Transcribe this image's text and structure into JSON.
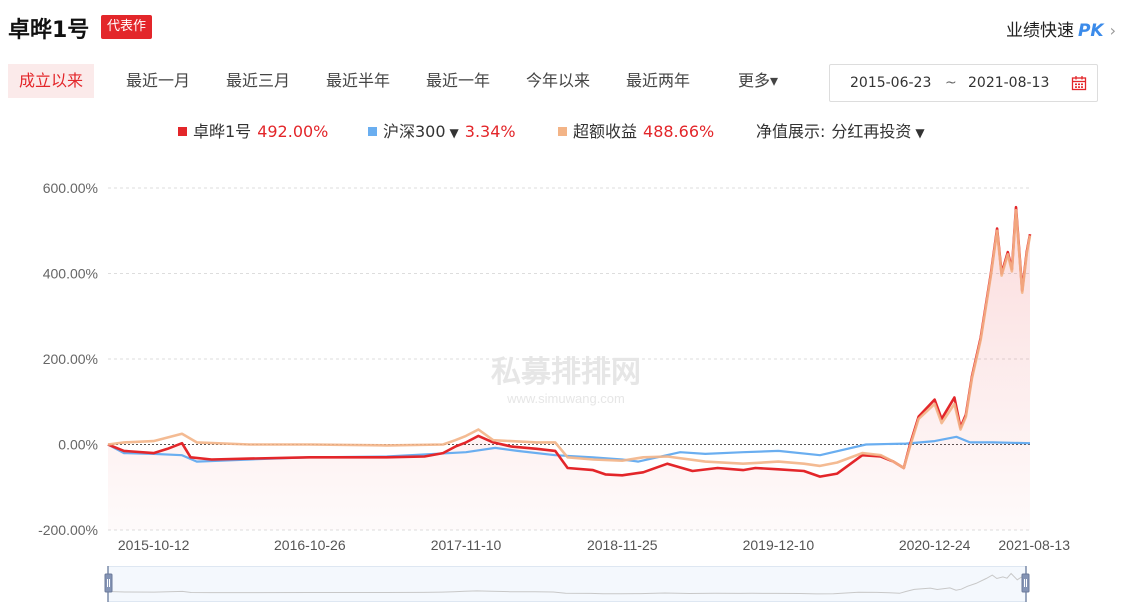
{
  "header": {
    "fund_name": "卓晔1号",
    "badge": "代表作",
    "pk_prefix": "业绩快速",
    "pk_strong": "PK",
    "pk_chevron": "›"
  },
  "tabs": [
    {
      "label": "成立以来",
      "active": true
    },
    {
      "label": "最近一月",
      "active": false
    },
    {
      "label": "最近三月",
      "active": false
    },
    {
      "label": "最近半年",
      "active": false
    },
    {
      "label": "最近一年",
      "active": false
    },
    {
      "label": "今年以来",
      "active": false
    },
    {
      "label": "最近两年",
      "active": false
    },
    {
      "label": "更多▾",
      "active": false
    }
  ],
  "date_range": {
    "start": "2015-06-23",
    "separator": "~",
    "end": "2021-08-13"
  },
  "legend": {
    "fund": {
      "label": "卓晔1号",
      "value": "492.00%",
      "color": "#e3262a"
    },
    "benchmark": {
      "label": "沪深300",
      "caret": "▼",
      "value": "3.34%",
      "color": "#6aaef0"
    },
    "excess": {
      "label": "超额收益",
      "value": "488.66%",
      "color": "#f3b487"
    },
    "nav_display": {
      "label": "净值展示:",
      "value": "分红再投资",
      "caret": "▼"
    }
  },
  "watermark": {
    "cn": "私募排排网",
    "en": "www.simuwang.com"
  },
  "colors": {
    "accent": "#e3262a",
    "benchmark": "#6aaef0",
    "excess": "#f3b487",
    "grid": "#dddddd"
  },
  "chart_data": {
    "type": "line",
    "title": "",
    "xlabel": "",
    "ylabel": "",
    "ylim": [
      -200,
      600
    ],
    "y_ticks": [
      "600.00%",
      "400.00%",
      "200.00%",
      "0.00%",
      "-200.00%"
    ],
    "y_tick_values": [
      600,
      400,
      200,
      0,
      -200
    ],
    "x_range": [
      "2015-06-23",
      "2021-08-13"
    ],
    "x_ticks": [
      "2015-10-12",
      "2016-10-26",
      "2017-11-10",
      "2018-11-25",
      "2019-12-10",
      "2020-12-24",
      "2021-08-13"
    ],
    "grid": true,
    "zero_line": "dashed",
    "legend_position": "top-center",
    "series": [
      {
        "name": "卓晔1号",
        "color": "#e3262a",
        "points": [
          [
            "2015-06-23",
            0
          ],
          [
            "2015-08-01",
            -15
          ],
          [
            "2015-10-12",
            -20
          ],
          [
            "2015-11-15",
            -10
          ],
          [
            "2015-12-20",
            3
          ],
          [
            "2016-01-10",
            -30
          ],
          [
            "2016-03-01",
            -35
          ],
          [
            "2016-06-01",
            -33
          ],
          [
            "2016-10-26",
            -30
          ],
          [
            "2017-02-01",
            -30
          ],
          [
            "2017-05-01",
            -30
          ],
          [
            "2017-08-01",
            -28
          ],
          [
            "2017-09-15",
            -20
          ],
          [
            "2017-10-15",
            -5
          ],
          [
            "2017-11-10",
            5
          ],
          [
            "2017-12-10",
            20
          ],
          [
            "2018-01-15",
            5
          ],
          [
            "2018-03-01",
            -5
          ],
          [
            "2018-05-01",
            -10
          ],
          [
            "2018-06-15",
            -15
          ],
          [
            "2018-07-15",
            -55
          ],
          [
            "2018-09-15",
            -60
          ],
          [
            "2018-10-15",
            -70
          ],
          [
            "2018-11-25",
            -72
          ],
          [
            "2019-01-15",
            -65
          ],
          [
            "2019-03-15",
            -45
          ],
          [
            "2019-05-15",
            -62
          ],
          [
            "2019-07-15",
            -55
          ],
          [
            "2019-09-15",
            -60
          ],
          [
            "2019-10-15",
            -55
          ],
          [
            "2019-12-10",
            -58
          ],
          [
            "2020-02-10",
            -62
          ],
          [
            "2020-03-20",
            -75
          ],
          [
            "2020-05-01",
            -68
          ],
          [
            "2020-07-01",
            -25
          ],
          [
            "2020-08-15",
            -28
          ],
          [
            "2020-09-15",
            -40
          ],
          [
            "2020-10-10",
            -55
          ],
          [
            "2020-10-25",
            0
          ],
          [
            "2020-11-15",
            65
          ],
          [
            "2020-12-24",
            105
          ],
          [
            "2021-01-10",
            60
          ],
          [
            "2021-02-10",
            110
          ],
          [
            "2021-02-25",
            40
          ],
          [
            "2021-03-10",
            70
          ],
          [
            "2021-03-25",
            160
          ],
          [
            "2021-04-15",
            250
          ],
          [
            "2021-05-10",
            400
          ],
          [
            "2021-05-25",
            505
          ],
          [
            "2021-06-05",
            400
          ],
          [
            "2021-06-20",
            450
          ],
          [
            "2021-06-30",
            410
          ],
          [
            "2021-07-10",
            555
          ],
          [
            "2021-07-25",
            360
          ],
          [
            "2021-08-05",
            450
          ],
          [
            "2021-08-13",
            492
          ]
        ]
      },
      {
        "name": "沪深300",
        "color": "#6aaef0",
        "points": [
          [
            "2015-06-23",
            0
          ],
          [
            "2015-08-01",
            -20
          ],
          [
            "2015-10-12",
            -22
          ],
          [
            "2015-12-20",
            -25
          ],
          [
            "2016-01-25",
            -40
          ],
          [
            "2016-06-01",
            -35
          ],
          [
            "2016-10-26",
            -30
          ],
          [
            "2017-05-01",
            -28
          ],
          [
            "2017-11-10",
            -18
          ],
          [
            "2018-01-20",
            -8
          ],
          [
            "2018-03-15",
            -15
          ],
          [
            "2018-06-15",
            -25
          ],
          [
            "2018-09-15",
            -30
          ],
          [
            "2018-11-25",
            -35
          ],
          [
            "2019-01-03",
            -40
          ],
          [
            "2019-04-15",
            -18
          ],
          [
            "2019-06-15",
            -22
          ],
          [
            "2019-09-15",
            -18
          ],
          [
            "2019-12-10",
            -15
          ],
          [
            "2020-03-20",
            -25
          ],
          [
            "2020-07-10",
            0
          ],
          [
            "2020-10-15",
            2
          ],
          [
            "2020-12-24",
            8
          ],
          [
            "2021-02-15",
            18
          ],
          [
            "2021-03-20",
            5
          ],
          [
            "2021-05-15",
            5
          ],
          [
            "2021-08-13",
            3
          ]
        ]
      },
      {
        "name": "超额收益",
        "color": "#f3b487",
        "points": [
          [
            "2015-06-23",
            0
          ],
          [
            "2015-08-01",
            5
          ],
          [
            "2015-10-12",
            8
          ],
          [
            "2015-12-20",
            25
          ],
          [
            "2016-01-25",
            5
          ],
          [
            "2016-06-01",
            0
          ],
          [
            "2016-10-26",
            0
          ],
          [
            "2017-05-01",
            -2
          ],
          [
            "2017-09-15",
            0
          ],
          [
            "2017-10-15",
            10
          ],
          [
            "2017-11-10",
            20
          ],
          [
            "2017-12-10",
            35
          ],
          [
            "2018-01-15",
            10
          ],
          [
            "2018-05-01",
            5
          ],
          [
            "2018-06-15",
            5
          ],
          [
            "2018-07-15",
            -30
          ],
          [
            "2018-09-15",
            -35
          ],
          [
            "2018-11-25",
            -38
          ],
          [
            "2019-01-15",
            -30
          ],
          [
            "2019-03-15",
            -28
          ],
          [
            "2019-06-15",
            -40
          ],
          [
            "2019-09-15",
            -45
          ],
          [
            "2019-12-10",
            -40
          ],
          [
            "2020-02-10",
            -45
          ],
          [
            "2020-03-20",
            -50
          ],
          [
            "2020-05-01",
            -42
          ],
          [
            "2020-07-01",
            -20
          ],
          [
            "2020-08-15",
            -25
          ],
          [
            "2020-09-15",
            -40
          ],
          [
            "2020-10-10",
            -55
          ],
          [
            "2020-10-25",
            -5
          ],
          [
            "2020-11-15",
            60
          ],
          [
            "2020-12-24",
            95
          ],
          [
            "2021-01-10",
            50
          ],
          [
            "2021-02-10",
            95
          ],
          [
            "2021-02-25",
            35
          ],
          [
            "2021-03-10",
            65
          ],
          [
            "2021-03-25",
            155
          ],
          [
            "2021-04-15",
            245
          ],
          [
            "2021-05-10",
            395
          ],
          [
            "2021-05-25",
            500
          ],
          [
            "2021-06-05",
            395
          ],
          [
            "2021-06-20",
            445
          ],
          [
            "2021-06-30",
            405
          ],
          [
            "2021-07-10",
            548
          ],
          [
            "2021-07-25",
            355
          ],
          [
            "2021-08-05",
            445
          ],
          [
            "2021-08-13",
            489
          ]
        ]
      }
    ]
  }
}
